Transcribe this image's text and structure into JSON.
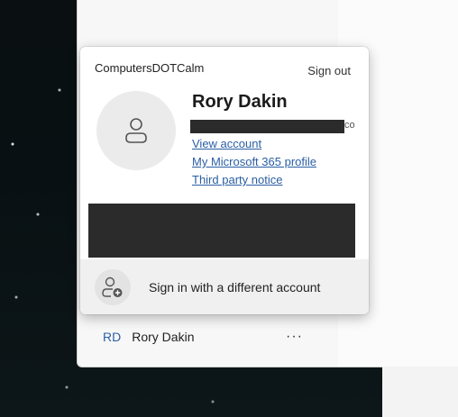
{
  "flyout": {
    "org_name": "ComputersDOTCalm",
    "sign_out_label": "Sign out",
    "user_name": "Rory Dakin",
    "email_suffix": "co",
    "links": {
      "view_account": "View account",
      "m365_profile": "My Microsoft 365 profile",
      "third_party": "Third party notice"
    },
    "alt_account_label": "Sign in with a different account"
  },
  "account_list": {
    "initials": "RD",
    "name": "Rory Dakin",
    "more_glyph": "···"
  },
  "icons": {
    "avatar": "person-icon",
    "alt_account": "add-person-icon",
    "more": "more-dots-icon"
  },
  "colors": {
    "link": "#2a5ea3",
    "initials": "#2c5fa8",
    "redaction": "#2b2b2b"
  }
}
